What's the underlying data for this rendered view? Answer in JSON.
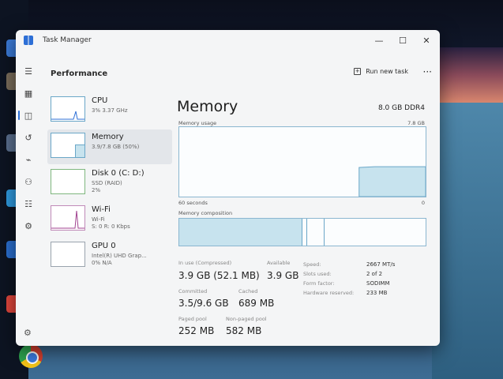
{
  "window": {
    "title": "Task Manager",
    "minimize_glyph": "—",
    "maximize_glyph": "☐",
    "close_glyph": "✕"
  },
  "header": {
    "title": "Performance",
    "run_task_label": "Run new task",
    "more_glyph": "···"
  },
  "rail": [
    "hamburger-icon",
    "processes-icon",
    "performance-icon",
    "history-icon",
    "startup-icon",
    "users-icon",
    "details-icon",
    "services-icon",
    "settings-icon"
  ],
  "devices": [
    {
      "name": "CPU",
      "sub": "3% 3.37 GHz"
    },
    {
      "name": "Memory",
      "sub": "3.9/7.8 GB (50%)"
    },
    {
      "name": "Disk 0 (C: D:)",
      "sub": "SSD (RAID)",
      "sub2": "2%"
    },
    {
      "name": "Wi-Fi",
      "sub": "Wi-Fi",
      "sub2": "S: 0 R: 0 Kbps"
    },
    {
      "name": "GPU 0",
      "sub": "Intel(R) UHD Grap...",
      "sub2": "0% N/A"
    }
  ],
  "main": {
    "title": "Memory",
    "ram_type": "8.0 GB DDR4",
    "usage_label": "Memory usage",
    "usage_max": "7.8 GB",
    "seconds_label": "60 seconds",
    "zero_label": "0",
    "composition_label": "Memory composition",
    "usage_fraction": 0.5
  },
  "stats": {
    "in_use_label": "In use (Compressed)",
    "in_use_value": "3.9 GB (52.1 MB)",
    "available_label": "Available",
    "available_value": "3.9 GB",
    "committed_label": "Committed",
    "committed_value": "3.5/9.6 GB",
    "cached_label": "Cached",
    "cached_value": "689 MB",
    "paged_label": "Paged pool",
    "paged_value": "252 MB",
    "nonpaged_label": "Non-paged pool",
    "nonpaged_value": "582 MB"
  },
  "details": {
    "speed_label": "Speed:",
    "speed_value": "2667 MT/s",
    "slots_label": "Slots used:",
    "slots_value": "2 of 2",
    "form_label": "Form factor:",
    "form_value": "SODIMM",
    "reserved_label": "Hardware reserved:",
    "reserved_value": "233 MB"
  },
  "colors": {
    "accent": "#2d6fd6",
    "memory_fill": "#c7e3ee",
    "memory_line": "#6aa7c8"
  }
}
